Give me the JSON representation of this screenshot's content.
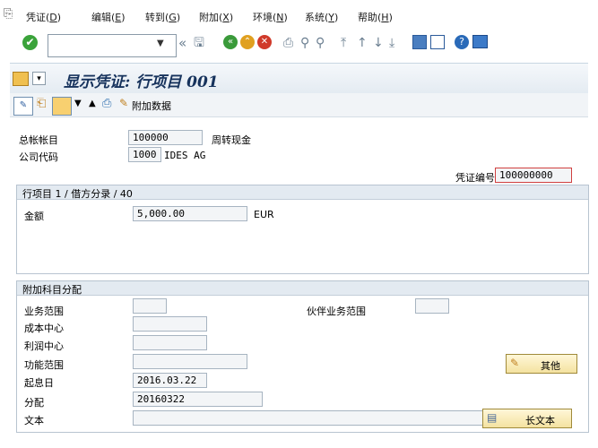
{
  "menu": [
    {
      "label": "凭证(",
      "key": "D",
      "end": ")"
    },
    {
      "label": "编辑(",
      "key": "E",
      "end": ")"
    },
    {
      "label": "转到(",
      "key": "G",
      "end": ")"
    },
    {
      "label": "附加(",
      "key": "X",
      "end": ")"
    },
    {
      "label": "环境(",
      "key": "N",
      "end": ")"
    },
    {
      "label": "系统(",
      "key": "Y",
      "end": ")"
    },
    {
      "label": "帮助(",
      "key": "H",
      "end": ")"
    }
  ],
  "toolbar": {
    "command_field_value": ""
  },
  "title": "显示凭证: 行项目 001",
  "apptoolbar": {
    "additional_data_label": "附加数据"
  },
  "header": {
    "gl_account_label": "总帐帐目",
    "gl_account_value": "100000",
    "gl_account_desc": "周转现金",
    "company_code_label": "公司代码",
    "company_code_value": "1000",
    "company_code_desc": "IDES AG",
    "doc_number_label": "凭证编号",
    "doc_number_value": "100000000"
  },
  "line_item": {
    "heading": "行项目 1 / 借方分录 / 40",
    "amount_label": "金额",
    "amount_value": "5,000.00",
    "currency": "EUR"
  },
  "assignment": {
    "heading": "附加科目分配",
    "business_area_label": "业务范围",
    "business_area_value": "",
    "partner_ba_label": "伙伴业务范围",
    "partner_ba_value": "",
    "cost_center_label": "成本中心",
    "cost_center_value": "",
    "profit_center_label": "利润中心",
    "profit_center_value": "",
    "functional_area_label": "功能范围",
    "functional_area_value": "",
    "value_date_label": "起息日",
    "value_date_value": "2016.03.22",
    "assignment_label": "分配",
    "assignment_value": "20160322",
    "text_label": "文本",
    "text_value": "",
    "more_button": "其他",
    "long_text_button": "长文本"
  }
}
